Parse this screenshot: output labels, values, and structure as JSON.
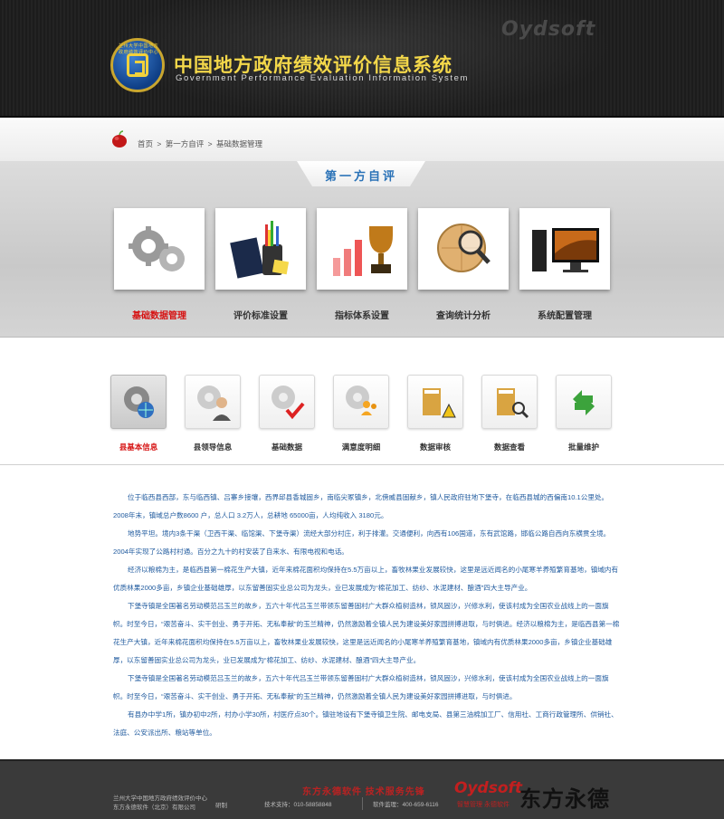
{
  "header": {
    "logo_ring_text": "兰州大学中国地方政府绩效评价中心",
    "logo_sub": "LOCOPE",
    "title_cn": "中国地方政府绩效评价信息系统",
    "title_en": "Government Performance Evaluation Information System",
    "brand": "Oydsoft"
  },
  "breadcrumb": {
    "items": [
      "首页",
      "第一方自评",
      "基础数据管理"
    ],
    "separator": ">"
  },
  "section_one": {
    "title": "第一方自评",
    "cards": [
      {
        "label": "基础数据管理",
        "icon": "gears-icon",
        "active": true
      },
      {
        "label": "评价标准设置",
        "icon": "pen-holder-icon",
        "active": false
      },
      {
        "label": "指标体系设置",
        "icon": "trophy-chart-icon",
        "active": false
      },
      {
        "label": "查询统计分析",
        "icon": "globe-magnifier-icon",
        "active": false
      },
      {
        "label": "系统配置管理",
        "icon": "computer-icon",
        "active": false
      }
    ]
  },
  "section_two": {
    "items": [
      {
        "label": "县基本信息",
        "icon": "globe-gear-icon",
        "active": true
      },
      {
        "label": "县领导信息",
        "icon": "user-gear-icon",
        "active": false
      },
      {
        "label": "基础数据",
        "icon": "check-gear-icon",
        "active": false
      },
      {
        "label": "满意度明细",
        "icon": "users-gear-icon",
        "active": false
      },
      {
        "label": "数据审核",
        "icon": "warning-stack-icon",
        "active": false
      },
      {
        "label": "数据查看",
        "icon": "search-stack-icon",
        "active": false
      },
      {
        "label": "批量维护",
        "icon": "arrows-icon",
        "active": false
      }
    ]
  },
  "content": {
    "paragraphs": [
      "位于临西县西部，东与临西镇、吕寨乡接壤，西界邱县香城固乡，南临尖冢镇乡，北傍威县固献乡，镇人民政府驻地下堡寺，在临西县城的西偏南10.1公里处。2008年末，镇域总户数8600 户，总人口 3.2万人，总耕地 65000亩，人均纯收入 3180元。",
      "地势平坦。境内3条干渠（卫西干渠、临馆渠、下堡寺渠）流经大部分村庄，利于排灌。交通便利，向西有106国道，东有武馆路，邯临公路自西向东横贯全境。2004年实现了公路村村通。百分之九十的村安装了自来水、有限电视和电话。",
      "经济以粮棉为主，是临西县第一棉花生产大镇，近年来棉花面积均保持在5.5万亩以上，畜牧林果业发展较快，这里是远近闻名的小尾寒羊养殖繁育基地，镇域内有优质林果2000多亩，乡镇企业基础雄厚，以东留善固实业总公司为龙头，业已发展成为“棉花加工、纺纱、水泥建材、酿酒”四大主导产业。",
      "下堡寺镇是全国著名劳动模范吕玉兰的故乡，五六十年代吕玉兰带领东留善固村广大群众植树造林，锁风固沙，兴修水利，使该村成为全国农业战线上的一面旗帜。时至今日，“艰苦奋斗、实干创业、勇于开拓、无私奉献”的玉兰精神，仍然激励着全镇人民为建设美好家园拼搏进取，与时俱进。经济以粮棉为主，是临西县第一棉花生产大镇，近年来棉花面积均保持在5.5万亩以上，畜牧林果业发展较快，这里是远近闻名的小尾寒羊养殖繁育基地，镇域内有优质林果2000多亩，乡镇企业基础雄厚，以东留善固实业总公司为龙头，业已发展成为“棉花加工、纺纱、水泥建材、酿酒”四大主导产业。",
      "下堡寺镇是全国著名劳动模范吕玉兰的故乡，五六十年代吕玉兰带领东留善固村广大群众植树造林，锁风固沙，兴修水利，使该村成为全国农业战线上的一面旗帜。时至今日，“艰苦奋斗、实干创业、勇于开拓、无私奉献”的玉兰精神，仍然激励着全镇人民为建设美好家园拼搏进取，与时俱进。",
      "有县办中学1所，镇办初中2所，村办小学30所，村医疗点30个。镇驻地设有下堡寺镇卫生院、邮电支局、县第三油棉加工厂、信用社、工商行政管理所、供销社、法庭、公安派出所、粮站等单位。"
    ]
  },
  "footer": {
    "org_line1": "兰州大学中国地方政府绩效评价中心",
    "org_line2": "东方永德软件（北京）有限公司",
    "develop_label": "研制",
    "slogan": "东方永德软件  技术服务先锋",
    "support": "技术支持：010-58858848",
    "hotline": "软件监理：400-659-6116",
    "brand": "Oydsoft",
    "brand_sub": "智慧管理  永德软件",
    "calligraphy": "东方永德"
  }
}
